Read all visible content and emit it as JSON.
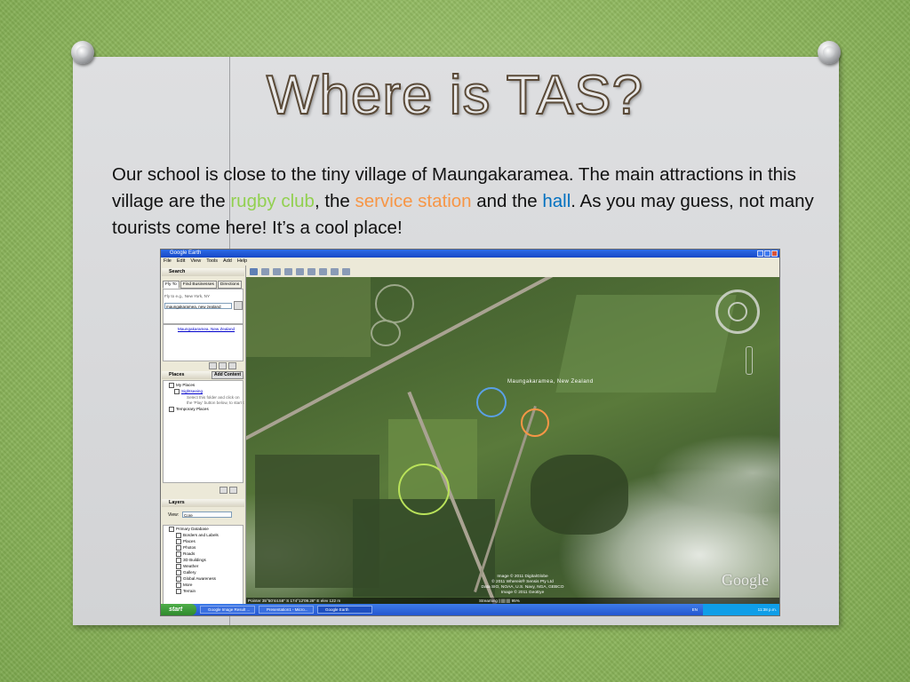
{
  "slide": {
    "title": "Where is TAS?",
    "paragraph": {
      "p1": "Our school is close to the tiny village of Maungakaramea.  The main attractions in this village are the ",
      "rugby_club": "rugby club",
      "p2": ", the ",
      "service_station": "service station",
      "p3": " and the ",
      "hall": "hall",
      "p4": ".  As you may guess, not many tourists come here! It’s a cool place!"
    },
    "colors": {
      "rugby_club": "#92d050",
      "service_station": "#f79646",
      "hall": "#0070c0"
    }
  },
  "google_earth": {
    "window_title": "Google Earth",
    "menu": [
      "File",
      "Edit",
      "View",
      "Tools",
      "Add",
      "Help"
    ],
    "search_panel": {
      "header": "Search",
      "tabs": [
        "Fly To",
        "Find Businesses",
        "Directions"
      ],
      "fly_to_hint": "Fly to e.g., New York, NY",
      "fly_to_value": "maungakaramea, new zealand",
      "result_link": "Maungakaramea, New Zealand"
    },
    "places_panel": {
      "header": "Places",
      "add_content": "Add Content",
      "items": [
        "My Places",
        "Sightseeing",
        "Select this folder and click on",
        "the 'Play' button below, to start t",
        "Temporary Places"
      ]
    },
    "layers_panel": {
      "header": "Layers",
      "view_label": "View:",
      "view_value": "Core",
      "items": [
        "Primary Database",
        "Borders and Labels",
        "Places",
        "Photos",
        "Roads",
        "3D Buildings",
        "Weather",
        "Gallery",
        "Global Awareness",
        "More",
        "Terrain"
      ]
    },
    "map": {
      "place_label": "Maungakaramea, New Zealand",
      "credits": [
        "Image © 2011 DigitalGlobe",
        "© 2011 Whereis® Sensis Pty Ltd",
        "Data SIO, NOAA, U.S. Navy, NGA, GEBCO",
        "Image © 2011 GeoEye"
      ],
      "logo": "Google",
      "status_left": "Pointer  35°50'44.58\" S  174°12'09.28\" E  elev  122 m",
      "streaming": "Streaming |||||||||||  95%",
      "markers": [
        {
          "name": "hall",
          "color": "#5aa0e6"
        },
        {
          "name": "service-station",
          "color": "#f79646"
        },
        {
          "name": "rugby-club",
          "color": "#b9e25a"
        }
      ]
    },
    "taskbar": {
      "start": "start",
      "tasks": [
        "Google Image Result ...",
        "Presentation1 - Micro...",
        "Google Earth"
      ],
      "lang": "EN",
      "clock": "11:38 p.m."
    }
  }
}
